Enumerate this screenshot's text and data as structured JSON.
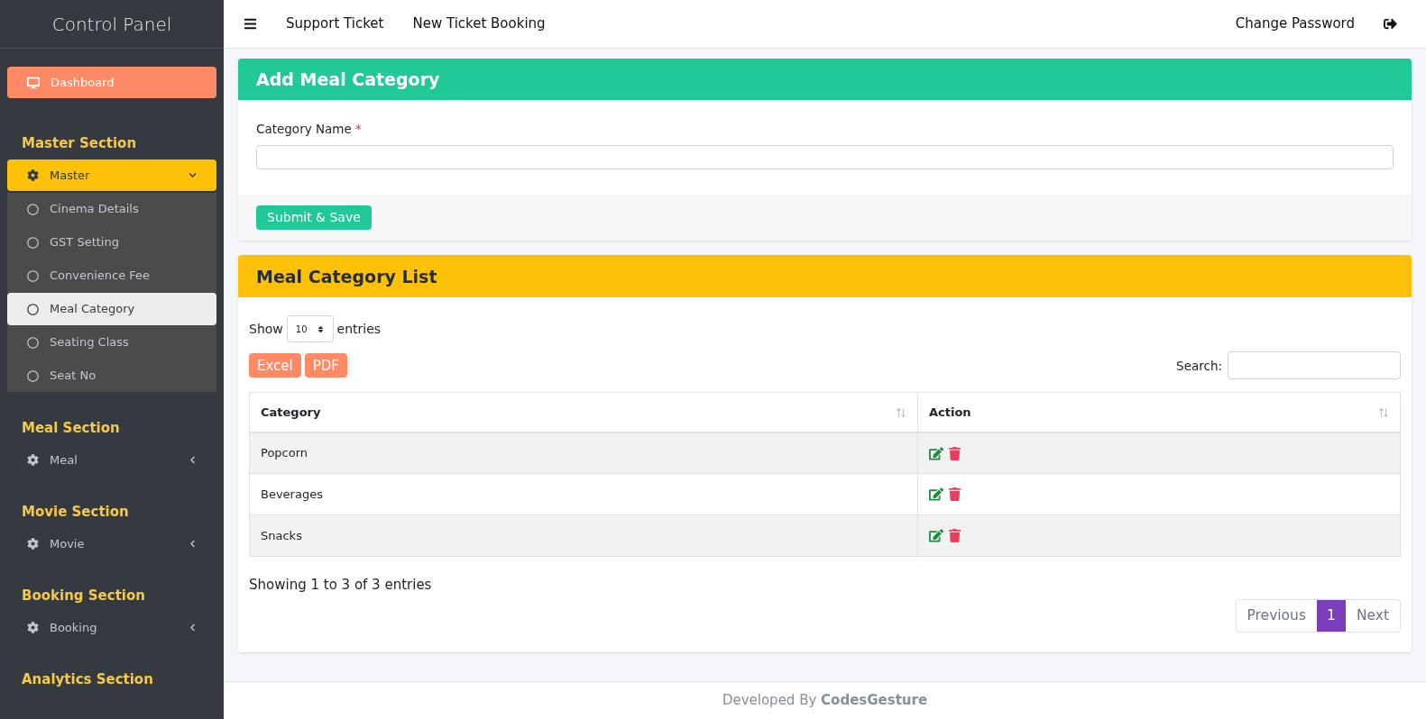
{
  "sidebar": {
    "brand": "Control Panel",
    "top_item": {
      "label": "Dashboard",
      "selected": true
    },
    "sections": [
      {
        "title": "Master Section",
        "menu": {
          "label": "Master",
          "expanded": true,
          "children": [
            {
              "label": "Cinema Details",
              "selected": false
            },
            {
              "label": "GST Setting",
              "selected": false
            },
            {
              "label": "Convenience Fee",
              "selected": false
            },
            {
              "label": "Meal Category",
              "selected": true
            },
            {
              "label": "Seating Class",
              "selected": false
            },
            {
              "label": "Seat No",
              "selected": false
            }
          ]
        }
      },
      {
        "title": "Meal Section",
        "menu": {
          "label": "Meal",
          "expanded": false
        }
      },
      {
        "title": "Movie Section",
        "menu": {
          "label": "Movie",
          "expanded": false
        }
      },
      {
        "title": "Booking Section",
        "menu": {
          "label": "Booking",
          "expanded": false
        }
      },
      {
        "title": "Analytics Section"
      }
    ]
  },
  "navbar": {
    "links": [
      "Support Ticket",
      "New Ticket Booking"
    ],
    "right_link": "Change Password"
  },
  "form_card": {
    "title": "Add Meal Category",
    "field": {
      "label": "Category Name",
      "required_mark": "*"
    },
    "submit": "Submit & Save"
  },
  "list_card": {
    "title": "Meal Category List",
    "show_label": "Show",
    "page_size": "10",
    "entries_label": "entries",
    "export_buttons": [
      "Excel",
      "PDF"
    ],
    "search_label": "Search:",
    "table": {
      "columns": [
        "Category",
        "Action"
      ],
      "rows": [
        {
          "category": "Popcorn"
        },
        {
          "category": "Beverages"
        },
        {
          "category": "Snacks"
        }
      ]
    },
    "info": "Showing 1 to 3 of 3 entries",
    "pagination": {
      "previous": "Previous",
      "pages": [
        {
          "label": "1",
          "selected": true
        }
      ],
      "next": "Next"
    }
  },
  "footer": "Developed By **CodesGesture**"
}
